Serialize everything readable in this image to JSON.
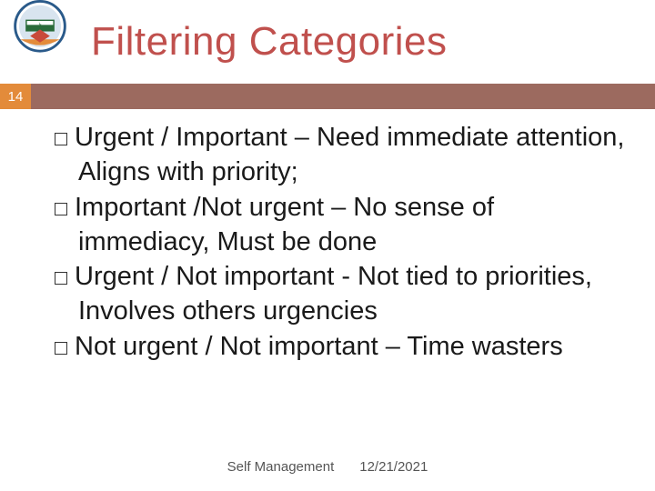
{
  "title": "Filtering Categories",
  "slide_number": "14",
  "bullets": [
    "Urgent / Important – Need immediate attention, Aligns with priority;",
    "Important /Not  urgent  – No sense of immediacy, Must be done",
    "Urgent / Not important -  Not tied to priorities, Involves others urgencies",
    "Not urgent / Not important – Time wasters"
  ],
  "footer": {
    "label": "Self Management",
    "date": "12/21/2021"
  }
}
